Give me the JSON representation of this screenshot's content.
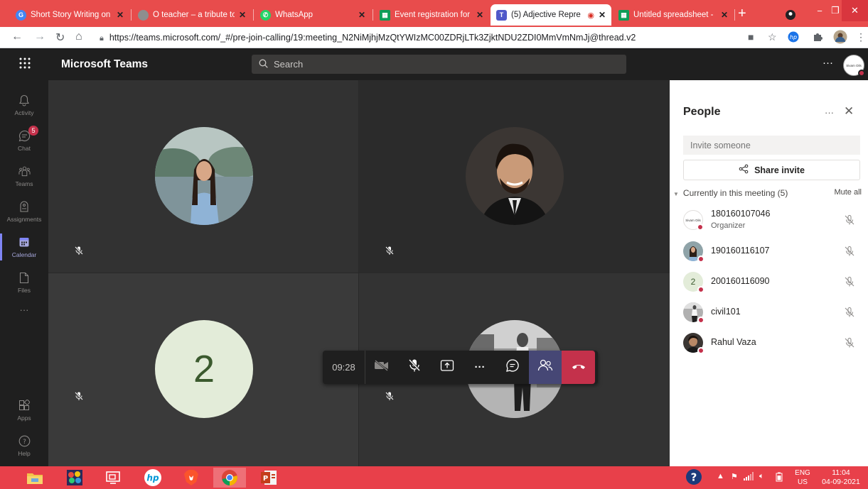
{
  "browser": {
    "tabs": [
      {
        "title": "Short Story Writing on",
        "favicon": "google-icon",
        "color": "#4285f4",
        "active": false
      },
      {
        "title": "O teacher – a tribute to",
        "favicon": "web-icon",
        "color": "#8e8e8e",
        "active": false
      },
      {
        "title": "WhatsApp",
        "favicon": "whatsapp-icon",
        "color": "#25d366",
        "active": false
      },
      {
        "title": "Event registration for T",
        "favicon": "sheets-icon",
        "color": "#0f9d58",
        "active": false
      },
      {
        "title": "(5) Adjective Repre",
        "favicon": "teams-icon",
        "color": "#5059c9",
        "active": true
      },
      {
        "title": "Untitled spreadsheet -",
        "favicon": "sheets-icon",
        "color": "#0f9d58",
        "active": false
      }
    ],
    "new_tab_label": "+",
    "url": "https://teams.microsoft.com/_#/pre-join-calling/19:meeting_N2NiMjhjMzQtYWIzMC00ZDRjLTk3ZjktNDU2ZDI0MmVmNmJj@thread.v2"
  },
  "teams": {
    "brand": "Microsoft Teams",
    "search_placeholder": "Search",
    "header_more": "···",
    "header_avatar_text": "Sivam Oils"
  },
  "rail": {
    "items": [
      {
        "label": "Activity",
        "icon": "bell-icon"
      },
      {
        "label": "Chat",
        "icon": "chat-icon",
        "badge": "5"
      },
      {
        "label": "Teams",
        "icon": "teams-icon"
      },
      {
        "label": "Assignments",
        "icon": "assignments-icon"
      },
      {
        "label": "Calendar",
        "icon": "calendar-icon",
        "active": true
      },
      {
        "label": "Files",
        "icon": "file-icon"
      }
    ],
    "more": "···",
    "bottom": [
      {
        "label": "Apps",
        "icon": "apps-icon"
      },
      {
        "label": "Help",
        "icon": "help-icon"
      }
    ]
  },
  "stage": {
    "tile3_initial": "2"
  },
  "controls": {
    "timer": "09:28",
    "more": "···"
  },
  "people": {
    "title": "People",
    "more": "···",
    "invite_placeholder": "Invite someone",
    "share_label": "Share invite",
    "section_label": "Currently in this meeting (5)",
    "mute_all": "Mute all",
    "participants": [
      {
        "name": "180160107046",
        "role": "Organizer",
        "avatar": "logo",
        "avatar_text": "Sivam Oils"
      },
      {
        "name": "190160116107",
        "role": "",
        "avatar": "photo"
      },
      {
        "name": "200160116090",
        "role": "",
        "avatar": "initial",
        "initial": "2"
      },
      {
        "name": "civil101",
        "role": "",
        "avatar": "photo"
      },
      {
        "name": "Rahul Vaza",
        "role": "",
        "avatar": "photo"
      }
    ]
  },
  "taskbar": {
    "lang_top": "ENG",
    "lang_bottom": "US",
    "time": "11:04",
    "date": "04-09-2021",
    "help_glyph": "?"
  },
  "colors": {
    "browser_frame": "#e84c4c",
    "teams_dark": "#1f1f1f",
    "accent": "#464775",
    "hangup": "#c4314b"
  }
}
